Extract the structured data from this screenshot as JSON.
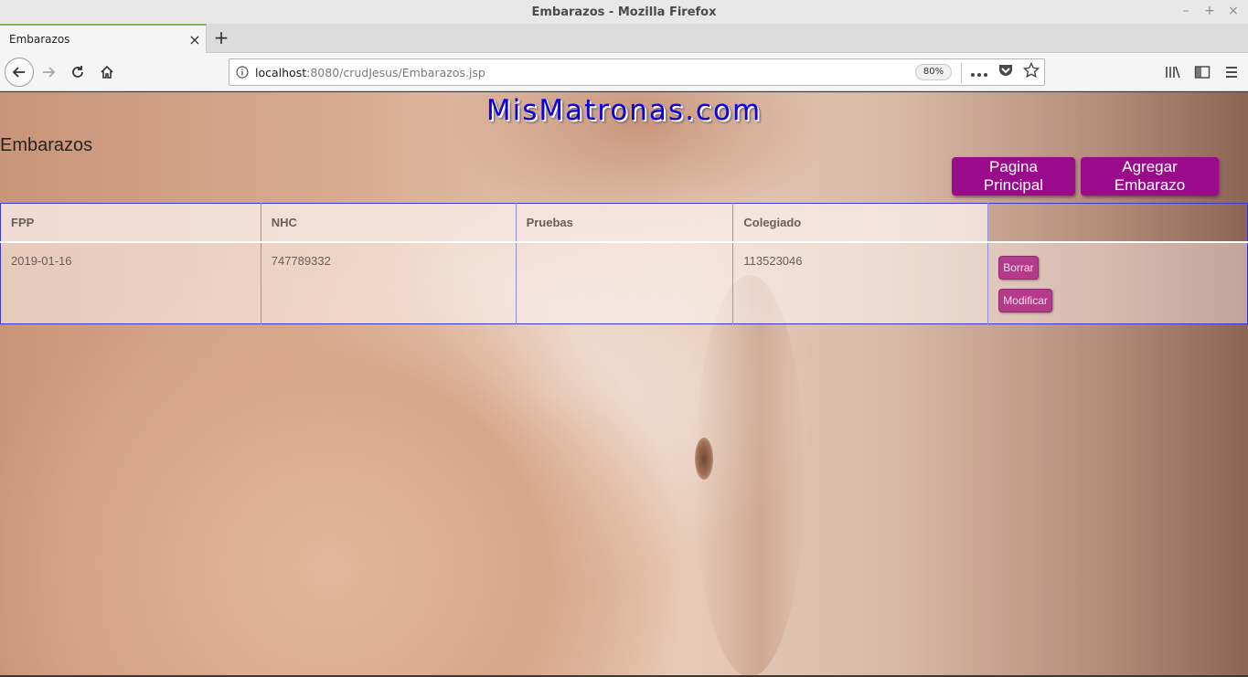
{
  "window": {
    "title": "Embarazos - Mozilla Firefox",
    "controls": [
      "–",
      "+",
      "×"
    ]
  },
  "tabs": [
    {
      "label": "Embarazos",
      "close": "×"
    }
  ],
  "new_tab": "+",
  "address_bar": {
    "host": "localhost",
    "rest": ":8080/crudJesus/Embarazos.jsp",
    "zoom": "80%"
  },
  "page": {
    "logo": "MisMatronas.com",
    "title": "Embarazos",
    "buttons": {
      "home": "Pagina Principal",
      "add": "Agregar Embarazo"
    },
    "table": {
      "columns": [
        "FPP",
        "NHC",
        "Pruebas",
        "Colegiado",
        ""
      ],
      "rows": [
        {
          "fpp": "2019-01-16",
          "nhc": "747789332",
          "pruebas": "",
          "colegiado": "113523046",
          "actions": {
            "delete": "Borrar",
            "edit": "Modificar"
          }
        }
      ]
    }
  },
  "colors": {
    "logo": "#0d00e6",
    "primary_button": "#9a0b8c",
    "row_button": "#b43b8b",
    "table_border": "#3b3bd4"
  }
}
